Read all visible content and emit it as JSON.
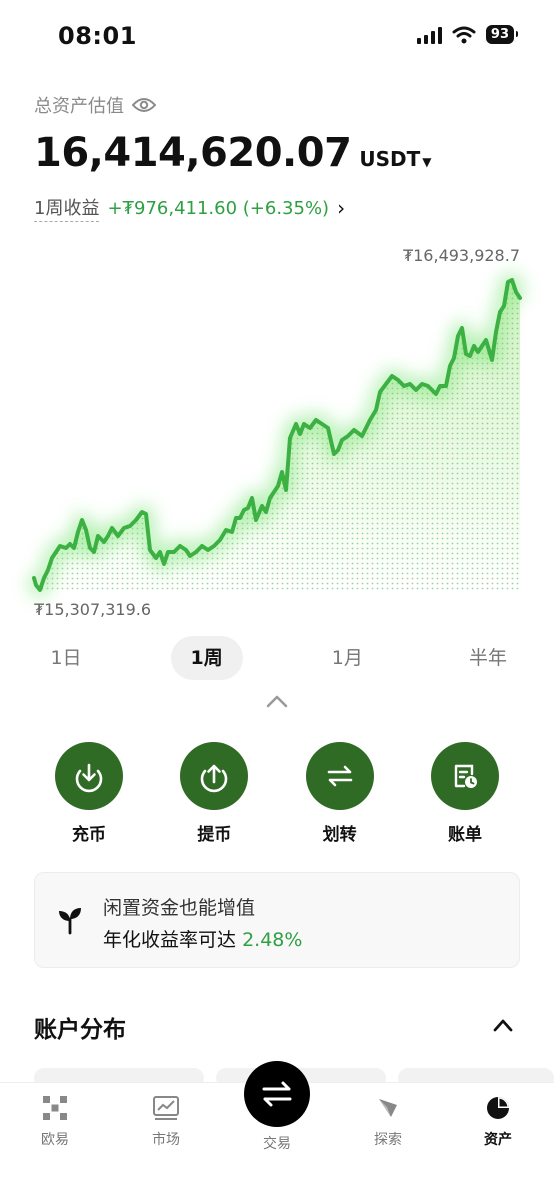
{
  "status_bar": {
    "time": "08:01",
    "battery": "93",
    "icons": [
      "signal-icon",
      "wifi-icon",
      "battery-icon"
    ]
  },
  "header": {
    "total_label": "总资产估值",
    "total_value": "16,414,620.07",
    "currency": "USDT",
    "week_label": "1周收益",
    "week_change": "+₮976,411.60 (+6.35%)"
  },
  "chart": {
    "max_label": "₮16,493,928.7",
    "min_label": "₮15,307,319.6",
    "accent_color": "#3cb043"
  },
  "range_tabs": [
    {
      "label": "1日",
      "active": false
    },
    {
      "label": "1周",
      "active": true
    },
    {
      "label": "1月",
      "active": false
    },
    {
      "label": "半年",
      "active": false
    }
  ],
  "actions": [
    {
      "label": "充币",
      "icon": "deposit-icon"
    },
    {
      "label": "提币",
      "icon": "withdraw-icon"
    },
    {
      "label": "划转",
      "icon": "transfer-icon"
    },
    {
      "label": "账单",
      "icon": "bill-icon"
    }
  ],
  "promo": {
    "line1": "闲置资金也能增值",
    "line2_prefix": "年化收益率可达",
    "rate": "2.48%"
  },
  "distribution": {
    "title": "账户分布"
  },
  "bottom_nav": [
    {
      "label": "欧易",
      "icon": "okx-logo-icon",
      "active": false
    },
    {
      "label": "市场",
      "icon": "market-chart-icon",
      "active": false
    },
    {
      "label": "交易",
      "icon": "trade-swap-icon",
      "active": false
    },
    {
      "label": "探索",
      "icon": "explore-compass-icon",
      "active": false
    },
    {
      "label": "资产",
      "icon": "assets-pie-icon",
      "active": true
    }
  ],
  "colors": {
    "action_green": "#2f6b25",
    "gain_green": "#2ea043"
  }
}
